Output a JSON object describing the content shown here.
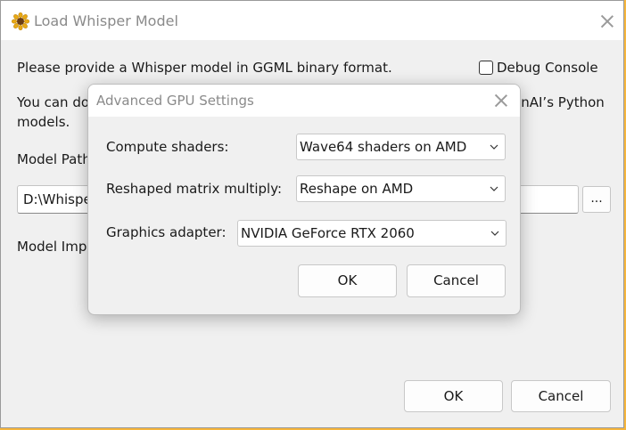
{
  "main_window": {
    "title": "Load Whisper Model",
    "intro_text": "Please provide a Whisper model in GGML binary format.",
    "debug_console_label": "Debug Console",
    "debug_console_checked": false,
    "conversion_line1_left": "You can do",
    "conversion_line1_right": "enAI’s Python",
    "conversion_line2": "models.",
    "model_path_label": "Model Path",
    "model_path_value": "D:\\Whispe",
    "browse_label": "...",
    "model_impl_label": "Model Imp",
    "ok_label": "OK",
    "cancel_label": "Cancel"
  },
  "dialog": {
    "title": "Advanced GPU Settings",
    "compute_shaders": {
      "label": "Compute shaders:",
      "value": "Wave64 shaders on AMD"
    },
    "reshaped_matrix": {
      "label": "Reshaped matrix multiply:",
      "value": "Reshape on AMD"
    },
    "graphics_adapter": {
      "label": "Graphics adapter:",
      "value": "NVIDIA GeForce RTX 2060"
    },
    "ok_label": "OK",
    "cancel_label": "Cancel"
  },
  "icons": {
    "app": "sunflower-icon",
    "close": "close-icon",
    "dropdown": "chevron-down-icon"
  },
  "colors": {
    "desktop": "#f6b53c",
    "window_bg": "#f0f0f0",
    "titlebar_bg": "#ffffff",
    "title_text": "#8a8a8a"
  }
}
